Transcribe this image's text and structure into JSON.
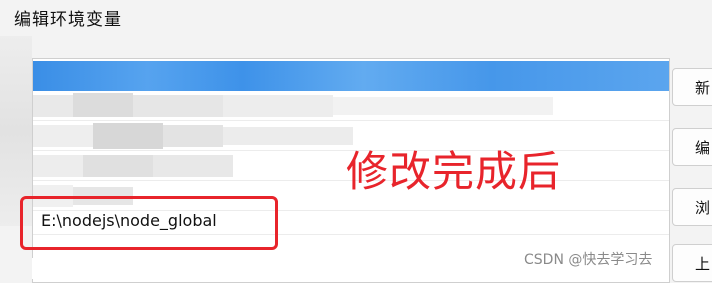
{
  "window": {
    "title": "编辑环境变量"
  },
  "path_list": {
    "visible_entry": "E:\\nodejs\\node_global"
  },
  "side_buttons": [
    {
      "label": "新"
    },
    {
      "label": "编"
    },
    {
      "label": "浏"
    },
    {
      "label": "上"
    }
  ],
  "annotation": {
    "text": "修改完成后",
    "color": "#e8242b"
  },
  "watermark": {
    "text": "CSDN @快去学习去"
  },
  "colors": {
    "selection": "#4a9ae9",
    "highlight": "#e8242b"
  }
}
